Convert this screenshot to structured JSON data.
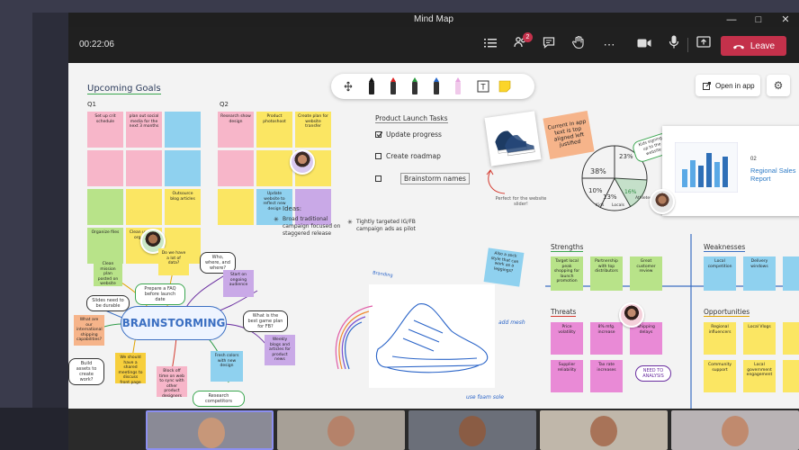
{
  "window": {
    "title": "Mind Map"
  },
  "call": {
    "timer": "00:22:06",
    "badge": "2",
    "leave_label": "Leave"
  },
  "board": {
    "open_in_app": "Open in app",
    "upcoming_goals": "Upcoming Goals",
    "q1": "Q1",
    "q2": "Q2",
    "q1_notes": [
      "Set up crit schedule",
      "plan out social media for the next 3 months",
      "",
      "",
      "",
      "",
      "",
      "",
      "Outsource blog articles",
      "Organize files",
      "Clean up work org. chart",
      ""
    ],
    "q2_notes": [
      "Research show design",
      "Product photoshoot",
      "Create plan for website transfer",
      "",
      "",
      "",
      "",
      "Update website to reflect new design",
      ""
    ],
    "product_launch": {
      "title": "Product Launch Tasks",
      "items": [
        "Update progress",
        "Create roadmap",
        "Brainstorm names"
      ]
    },
    "sticky_current": "Current in app text is top aligned left justified",
    "shoe_caption": "Perfect for the website slider!",
    "ideas": {
      "title": "Ideas:",
      "idea1": "Broad traditional campaign focused on staggered release",
      "idea2": "Tightly targeted IG/FB campaign ads as pilot"
    },
    "pie": {
      "labels": [
        "38%",
        "23%",
        "16%",
        "13%",
        "10%"
      ],
      "captions": [
        "Kids",
        "Locals",
        "Athletes",
        "Everyday",
        "Elders"
      ],
      "callout": "Kids signing up to the website"
    },
    "slide": {
      "number": "02",
      "title": "Regional Sales Report"
    },
    "brainstorming": "BRAINSTORMING",
    "mind_nodes": {
      "who": "Who, where, and where?",
      "what_best": "What is the best game plan for FB?",
      "prepare_faq": "Prepare a FAQ before launch date",
      "slides": "Slides need to be durable",
      "build_assets": "Build assets to create work?",
      "research": "Research competitors"
    },
    "mind_notes": [
      "Clean mission plan posted on website",
      "Do we have a lot of data?",
      "Start on ongoing audience",
      "What are our international shipping capabilities?",
      "We should have a shared meetings to discuss front page",
      "Block off time on web to sync with other product designers",
      "Fresh colors with new design",
      "Weekly blogs and articles for product news"
    ],
    "sketch_notes": {
      "heading": "Branding",
      "add_mesh": "add mesh",
      "use_rubber": "use foam sole"
    },
    "sticky_blue": "Also a sock style that can work as a leggings?",
    "swot": {
      "strengths": "Strengths",
      "weaknesses": "Weaknesses",
      "threats": "Threats",
      "opportunities": "Opportunities",
      "strength_notes": [
        "Target local peak shopping for launch promotion",
        "Partnership with top distributors",
        "Great customer review"
      ],
      "weakness_notes": [
        "Local competition",
        "Delivery windows",
        ""
      ],
      "threat_notes": [
        "Price volatility",
        "8% mfg. increase",
        "Shipping delays",
        "Supplier reliability",
        "Tax rate increases"
      ],
      "need_analysis": "NEED TO ANALYSIS",
      "opp_notes": [
        "Regional influencers",
        "Local Vlogs",
        "",
        "Community support",
        "Local government engagement",
        ""
      ]
    }
  },
  "colors": {
    "leave": "#c4314b",
    "board_bg": "#f3f3f3",
    "brainstorm_blue": "#3b6fc2"
  },
  "icons": [
    "participants-icon",
    "people-icon",
    "chat-icon",
    "raise-hand-icon",
    "more-icon",
    "camera-icon",
    "mic-icon",
    "share-icon",
    "phone-hangup-icon"
  ]
}
